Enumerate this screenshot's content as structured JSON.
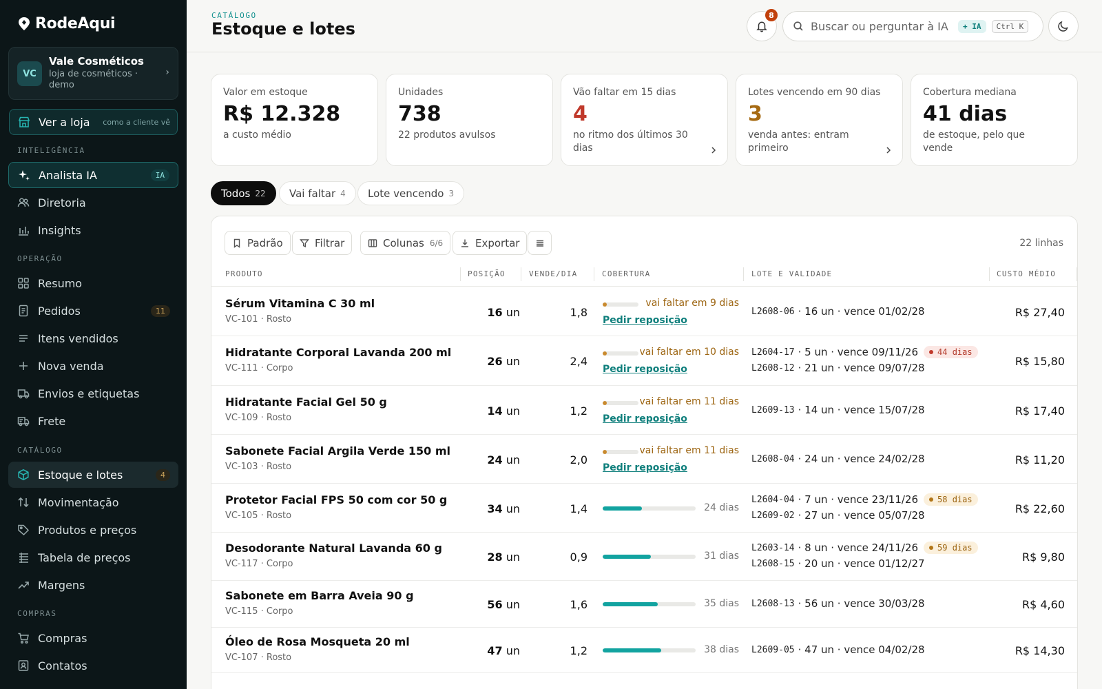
{
  "app": {
    "logo_text": "RodeAqui"
  },
  "store": {
    "avatar": "VC",
    "name": "Vale Cosméticos",
    "subtitle": "loja de cosméticos · demo"
  },
  "ver_loja": {
    "label": "Ver a loja",
    "hint": "como a cliente vê"
  },
  "sections": {
    "inteligencia": "INTELIGÊNCIA",
    "operacao": "OPERAÇÃO",
    "catalogo": "CATÁLOGO",
    "compras": "COMPRAS"
  },
  "nav": {
    "analista": {
      "label": "Analista IA",
      "badge": "IA"
    },
    "diretoria": {
      "label": "Diretoria"
    },
    "insights": {
      "label": "Insights"
    },
    "resumo": {
      "label": "Resumo"
    },
    "pedidos": {
      "label": "Pedidos",
      "badge": "11"
    },
    "itens": {
      "label": "Itens vendidos"
    },
    "nova_venda": {
      "label": "Nova venda"
    },
    "envios": {
      "label": "Envios e etiquetas"
    },
    "frete": {
      "label": "Frete"
    },
    "estoque": {
      "label": "Estoque e lotes",
      "badge": "4"
    },
    "movimentacao": {
      "label": "Movimentação"
    },
    "produtos": {
      "label": "Produtos e preços"
    },
    "tabela": {
      "label": "Tabela de preços"
    },
    "margens": {
      "label": "Margens"
    },
    "compras": {
      "label": "Compras"
    },
    "contatos": {
      "label": "Contatos"
    }
  },
  "header": {
    "breadcrumb": "CATÁLOGO",
    "title": "Estoque e lotes",
    "notifications": "8",
    "search_placeholder": "Buscar ou perguntar à IA",
    "ia_chip": "+ IA",
    "shortcut": "Ctrl K"
  },
  "kpis": [
    {
      "label": "Valor em estoque",
      "value": "R$ 12.328",
      "sub": "a custo médio"
    },
    {
      "label": "Unidades",
      "value": "738",
      "sub": "22 produtos avulsos"
    },
    {
      "label": "Vão faltar em 15 dias",
      "value": "4",
      "sub": "no ritmo dos últimos 30 dias"
    },
    {
      "label": "Lotes vencendo em 90 dias",
      "value": "3",
      "sub": "venda antes: entram primeiro"
    },
    {
      "label": "Cobertura mediana",
      "value": "41 dias",
      "sub": "de estoque, pelo que vende"
    }
  ],
  "filters": [
    {
      "label": "Todos",
      "count": "22"
    },
    {
      "label": "Vai faltar",
      "count": "4"
    },
    {
      "label": "Lote vencendo",
      "count": "3"
    }
  ],
  "toolbar": {
    "padrao": "Padrão",
    "filtrar": "Filtrar",
    "colunas": "Colunas",
    "colunas_count": "6/6",
    "exportar": "Exportar",
    "rows_count": "22 linhas"
  },
  "columns": {
    "produto": "PRODUTO",
    "posicao": "POSIÇÃO",
    "vende": "VENDE/DIA",
    "cobertura": "COBERTURA",
    "lote": "LOTE E VALIDADE",
    "custo": "CUSTO MÉDIO"
  },
  "colors": {
    "teal": "#12a3a0",
    "warn_amber": "#c98a2e",
    "danger": "#c0392b",
    "sidebar_bg": "#0c1618"
  },
  "rows": [
    {
      "name": "Sérum Vitamina C 30 ml",
      "sku": "VC-101 · Rosto",
      "qty": "16",
      "unit": "un",
      "daily": "1,8",
      "coverage": {
        "text": "vai faltar em 9 dias",
        "fill_pct": 8,
        "warn": true,
        "action": "Pedir reposição"
      },
      "lots": [
        {
          "code": "L2608-06",
          "text": "· 16 un · vence 01/02/28"
        }
      ],
      "cost": "R$ 27,40"
    },
    {
      "name": "Hidratante Corporal Lavanda 200 ml",
      "sku": "VC-111 · Corpo",
      "qty": "26",
      "unit": "un",
      "daily": "2,4",
      "coverage": {
        "text": "vai faltar em 10 dias",
        "fill_pct": 8,
        "warn": true,
        "action": "Pedir reposição"
      },
      "lots": [
        {
          "code": "L2604-17",
          "text": "· 5 un · vence 09/11/26",
          "tag": "44 dias",
          "tag_style": "red"
        },
        {
          "code": "L2608-12",
          "text": "· 21 un · vence 09/07/28"
        }
      ],
      "cost": "R$ 15,80"
    },
    {
      "name": "Hidratante Facial Gel 50 g",
      "sku": "VC-109 · Rosto",
      "qty": "14",
      "unit": "un",
      "daily": "1,2",
      "coverage": {
        "text": "vai faltar em 11 dias",
        "fill_pct": 9,
        "warn": true,
        "action": "Pedir reposição"
      },
      "lots": [
        {
          "code": "L2609-13",
          "text": "· 14 un · vence 15/07/28"
        }
      ],
      "cost": "R$ 17,40"
    },
    {
      "name": "Sabonete Facial Argila Verde 150 ml",
      "sku": "VC-103 · Rosto",
      "qty": "24",
      "unit": "un",
      "daily": "2,0",
      "coverage": {
        "text": "vai faltar em 11 dias",
        "fill_pct": 9,
        "warn": true,
        "action": "Pedir reposição"
      },
      "lots": [
        {
          "code": "L2608-04",
          "text": "· 24 un · vence 24/02/28"
        }
      ],
      "cost": "R$ 11,20"
    },
    {
      "name": "Protetor Facial FPS 50 com cor 50 g",
      "sku": "VC-105 · Rosto",
      "qty": "34",
      "unit": "un",
      "daily": "1,4",
      "coverage": {
        "text": "24 dias",
        "fill_pct": 42,
        "warn": false
      },
      "lots": [
        {
          "code": "L2604-04",
          "text": "· 7 un · vence 23/11/26",
          "tag": "58 dias",
          "tag_style": "amber"
        },
        {
          "code": "L2609-02",
          "text": "· 27 un · vence 05/07/28"
        }
      ],
      "cost": "R$ 22,60"
    },
    {
      "name": "Desodorante Natural Lavanda 60 g",
      "sku": "VC-117 · Corpo",
      "qty": "28",
      "unit": "un",
      "daily": "0,9",
      "coverage": {
        "text": "31 dias",
        "fill_pct": 52,
        "warn": false
      },
      "lots": [
        {
          "code": "L2603-14",
          "text": "· 8 un · vence 24/11/26",
          "tag": "59 dias",
          "tag_style": "amber"
        },
        {
          "code": "L2608-15",
          "text": "· 20 un · vence 01/12/27"
        }
      ],
      "cost": "R$ 9,80"
    },
    {
      "name": "Sabonete em Barra Aveia 90 g",
      "sku": "VC-115 · Corpo",
      "qty": "56",
      "unit": "un",
      "daily": "1,6",
      "coverage": {
        "text": "35 dias",
        "fill_pct": 59,
        "warn": false
      },
      "lots": [
        {
          "code": "L2608-13",
          "text": "· 56 un · vence 30/03/28"
        }
      ],
      "cost": "R$ 4,60"
    },
    {
      "name": "Óleo de Rosa Mosqueta 20 ml",
      "sku": "VC-107 · Rosto",
      "qty": "47",
      "unit": "un",
      "daily": "1,2",
      "coverage": {
        "text": "38 dias",
        "fill_pct": 63,
        "warn": false
      },
      "lots": [
        {
          "code": "L2609-05",
          "text": "· 47 un · vence 04/02/28"
        }
      ],
      "cost": "R$ 14,30"
    }
  ]
}
